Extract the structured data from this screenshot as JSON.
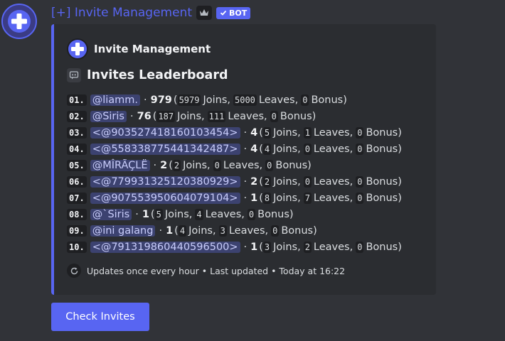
{
  "header": {
    "username": "[+] Invite Management",
    "bot_tag": "BOT",
    "icons": [
      "plus-icon",
      "crown-icon",
      "checkmark-icon"
    ]
  },
  "embed": {
    "accent_color": "#5865f2",
    "author": "Invite Management",
    "title": "Invites Leaderboard",
    "rows": [
      {
        "rank": "01.",
        "user": "@liamm.",
        "score": "979",
        "joins": "5979",
        "leaves": "5000",
        "bonus": "0"
      },
      {
        "rank": "02.",
        "user": "@Siris",
        "score": "76",
        "joins": "187",
        "leaves": "111",
        "bonus": "0"
      },
      {
        "rank": "03.",
        "user": "<@903527418160103454>",
        "score": "4",
        "joins": "5",
        "leaves": "1",
        "bonus": "0"
      },
      {
        "rank": "04.",
        "user": "<@558338775441342487>",
        "score": "4",
        "joins": "4",
        "leaves": "0",
        "bonus": "0"
      },
      {
        "rank": "05.",
        "user": "@MÎRÃÇLË",
        "score": "2",
        "joins": "2",
        "leaves": "0",
        "bonus": "0"
      },
      {
        "rank": "06.",
        "user": "<@779931325120380929>",
        "score": "2",
        "joins": "2",
        "leaves": "0",
        "bonus": "0"
      },
      {
        "rank": "07.",
        "user": "<@907553950604079104>",
        "score": "1",
        "joins": "8",
        "leaves": "7",
        "bonus": "0"
      },
      {
        "rank": "08.",
        "user": "@`Siris",
        "score": "1",
        "joins": "5",
        "leaves": "4",
        "bonus": "0"
      },
      {
        "rank": "09.",
        "user": "@ini galang",
        "score": "1",
        "joins": "4",
        "leaves": "3",
        "bonus": "0"
      },
      {
        "rank": "10.",
        "user": "<@791319860440596500>",
        "score": "1",
        "joins": "3",
        "leaves": "2",
        "bonus": "0"
      }
    ],
    "labels": {
      "joins": "Joins,",
      "leaves": "Leaves,",
      "bonus": "Bonus)",
      "open_paren": "(",
      "separator": "·"
    },
    "footer": {
      "text": "Updates once every hour • Last updated • Today at 16:22",
      "icon": "refresh-icon"
    }
  },
  "button": {
    "label": "Check Invites"
  }
}
